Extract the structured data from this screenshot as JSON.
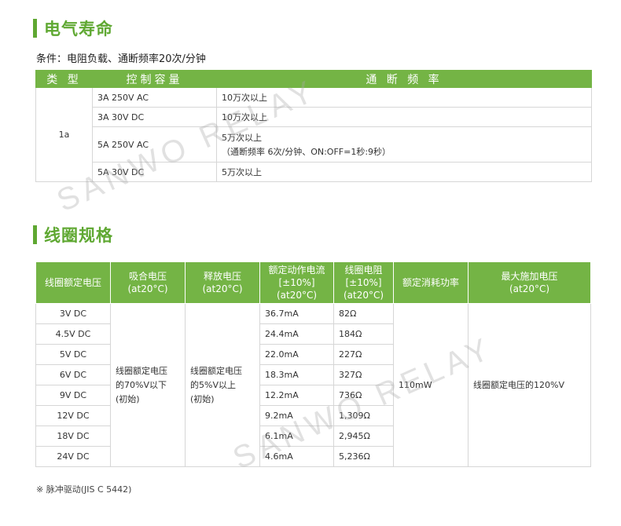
{
  "section1": {
    "title": "电气寿命",
    "condition": "条件：电阻负载、通断频率20次/分钟",
    "headers": [
      "类 型",
      "控制容量",
      "通 断 频 率"
    ],
    "type": "1a",
    "rows": [
      {
        "capacity": "3A 250V AC",
        "frequency": "10万次以上",
        "note": ""
      },
      {
        "capacity": "3A 30V DC",
        "frequency": "10万次以上",
        "note": ""
      },
      {
        "capacity": "5A 250V AC",
        "frequency": "5万次以上",
        "note": "（通断频率 6次/分钟、ON:OFF=1秒:9秒）"
      },
      {
        "capacity": "5A 30V DC",
        "frequency": "5万次以上",
        "note": ""
      }
    ]
  },
  "section2": {
    "title": "线圈规格",
    "headers": {
      "rated_voltage": "线圈额定电压",
      "pickup_voltage": [
        "吸合电压",
        "(at20°C)"
      ],
      "release_voltage": [
        "释放电压",
        "(at20°C)"
      ],
      "operate_current": [
        "额定动作电流",
        "[±10%]",
        "(at20°C)"
      ],
      "coil_resistance": [
        "线圈电阻",
        "[±10%]",
        "(at20°C)"
      ],
      "power": "额定消耗功率",
      "max_voltage": [
        "最大施加电压",
        "(at20°C)"
      ]
    },
    "pickup": [
      "线圈额定电压",
      "的70%V以下",
      "(初始)"
    ],
    "release": [
      "线圈额定电压",
      "的5%V以上",
      "(初始)"
    ],
    "power_value": "110mW",
    "max_value": "线圈额定电压的120%V",
    "rows": [
      {
        "voltage": "3V DC",
        "current": "36.7mA",
        "resistance": "82Ω"
      },
      {
        "voltage": "4.5V DC",
        "current": "24.4mA",
        "resistance": "184Ω"
      },
      {
        "voltage": "5V DC",
        "current": "22.0mA",
        "resistance": "227Ω"
      },
      {
        "voltage": "6V DC",
        "current": "18.3mA",
        "resistance": "327Ω"
      },
      {
        "voltage": "9V DC",
        "current": "12.2mA",
        "resistance": "736Ω"
      },
      {
        "voltage": "12V DC",
        "current": "9.2mA",
        "resistance": "1,309Ω"
      },
      {
        "voltage": "18V DC",
        "current": "6.1mA",
        "resistance": "2,945Ω"
      },
      {
        "voltage": "24V DC",
        "current": "4.6mA",
        "resistance": "5,236Ω"
      }
    ]
  },
  "note": "※ 脉冲驱动(JIS C 5442)",
  "watermark": "SANWO RELAY",
  "colors": {
    "accent": "#5fa832",
    "header_bg": "#74b445"
  }
}
